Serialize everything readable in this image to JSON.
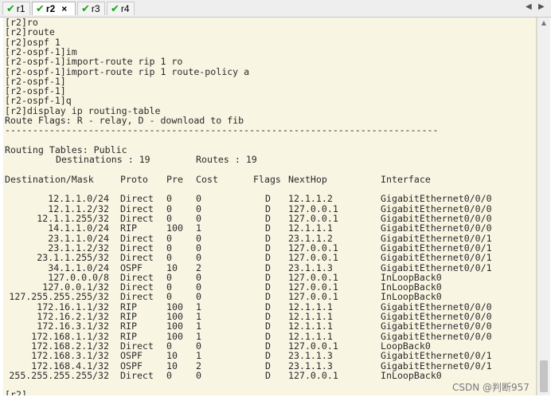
{
  "tabs": [
    {
      "label": "r1",
      "active": false
    },
    {
      "label": "r2",
      "active": true,
      "close_glyph": "×"
    },
    {
      "label": "r3",
      "active": false
    },
    {
      "label": "r4",
      "active": false
    }
  ],
  "nav": {
    "left_glyph": "◀",
    "right_glyph": "▶"
  },
  "terminal": {
    "background": "#f9f5e3",
    "command_lines": [
      "[r2]ro",
      "[r2]route",
      "[r2]ospf 1",
      "[r2-ospf-1]im",
      "[r2-ospf-1]import-route rip 1 ro",
      "[r2-ospf-1]import-route rip 1 route-policy a",
      "[r2-ospf-1]",
      "[r2-ospf-1]",
      "[r2-ospf-1]q",
      "[r2]display ip routing-table",
      "Route Flags: R - relay, D - download to fib",
      "------------------------------------------------------------------------------"
    ],
    "summary": {
      "tables_line": "Routing Tables: Public",
      "destinations_label": "Destinations : 19",
      "routes_label": "Routes : 19"
    },
    "headers": [
      "Destination/Mask",
      "Proto",
      "Pre",
      "Cost",
      "Flags",
      "NextHop",
      "Interface"
    ],
    "routes": [
      [
        "12.1.1.0/24",
        "Direct",
        "0",
        "0",
        "D",
        "12.1.1.2",
        "GigabitEthernet0/0/0"
      ],
      [
        "12.1.1.2/32",
        "Direct",
        "0",
        "0",
        "D",
        "127.0.0.1",
        "GigabitEthernet0/0/0"
      ],
      [
        "12.1.1.255/32",
        "Direct",
        "0",
        "0",
        "D",
        "127.0.0.1",
        "GigabitEthernet0/0/0"
      ],
      [
        "14.1.1.0/24",
        "RIP",
        "100",
        "1",
        "D",
        "12.1.1.1",
        "GigabitEthernet0/0/0"
      ],
      [
        "23.1.1.0/24",
        "Direct",
        "0",
        "0",
        "D",
        "23.1.1.2",
        "GigabitEthernet0/0/1"
      ],
      [
        "23.1.1.2/32",
        "Direct",
        "0",
        "0",
        "D",
        "127.0.0.1",
        "GigabitEthernet0/0/1"
      ],
      [
        "23.1.1.255/32",
        "Direct",
        "0",
        "0",
        "D",
        "127.0.0.1",
        "GigabitEthernet0/0/1"
      ],
      [
        "34.1.1.0/24",
        "OSPF",
        "10",
        "2",
        "D",
        "23.1.1.3",
        "GigabitEthernet0/0/1"
      ],
      [
        "127.0.0.0/8",
        "Direct",
        "0",
        "0",
        "D",
        "127.0.0.1",
        "InLoopBack0"
      ],
      [
        "127.0.0.1/32",
        "Direct",
        "0",
        "0",
        "D",
        "127.0.0.1",
        "InLoopBack0"
      ],
      [
        "127.255.255.255/32",
        "Direct",
        "0",
        "0",
        "D",
        "127.0.0.1",
        "InLoopBack0"
      ],
      [
        "172.16.1.1/32",
        "RIP",
        "100",
        "1",
        "D",
        "12.1.1.1",
        "GigabitEthernet0/0/0"
      ],
      [
        "172.16.2.1/32",
        "RIP",
        "100",
        "1",
        "D",
        "12.1.1.1",
        "GigabitEthernet0/0/0"
      ],
      [
        "172.16.3.1/32",
        "RIP",
        "100",
        "1",
        "D",
        "12.1.1.1",
        "GigabitEthernet0/0/0"
      ],
      [
        "172.168.1.1/32",
        "RIP",
        "100",
        "1",
        "D",
        "12.1.1.1",
        "GigabitEthernet0/0/0"
      ],
      [
        "172.168.2.1/32",
        "Direct",
        "0",
        "0",
        "D",
        "127.0.0.1",
        "LoopBack0"
      ],
      [
        "172.168.3.1/32",
        "OSPF",
        "10",
        "1",
        "D",
        "23.1.1.3",
        "GigabitEthernet0/0/1"
      ],
      [
        "172.168.4.1/32",
        "OSPF",
        "10",
        "2",
        "D",
        "23.1.1.3",
        "GigabitEthernet0/0/1"
      ],
      [
        "255.255.255.255/32",
        "Direct",
        "0",
        "0",
        "D",
        "127.0.0.1",
        "InLoopBack0"
      ]
    ],
    "prompt": "[r2]"
  },
  "watermark": "CSDN @判断957"
}
